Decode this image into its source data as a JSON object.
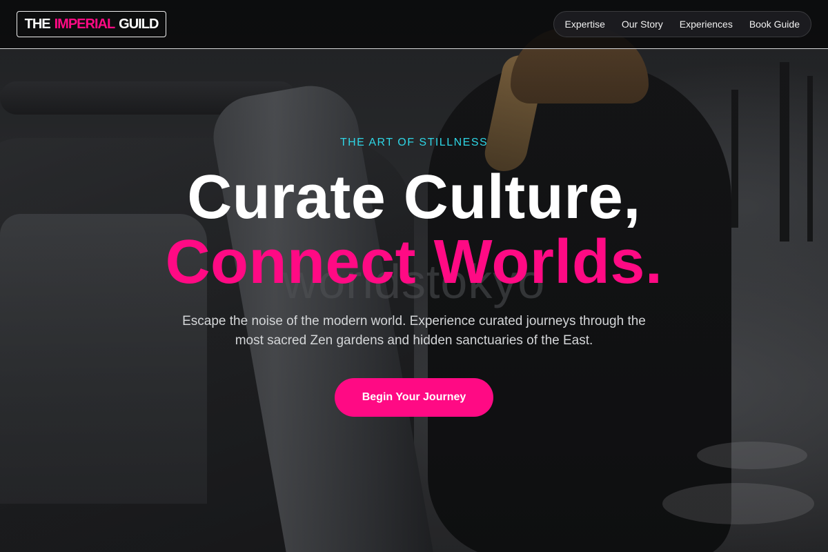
{
  "brand": {
    "logo_part1": "THE",
    "logo_part2": "IMPERIAL",
    "logo_part3": "GUILD"
  },
  "nav": {
    "items": [
      {
        "label": "Expertise"
      },
      {
        "label": "Our Story"
      },
      {
        "label": "Experiences"
      },
      {
        "label": "Book Guide"
      }
    ]
  },
  "hero": {
    "eyebrow": "THE ART OF STILLNESS",
    "headline_line1": "Curate Culture,",
    "headline_line2": "Connect Worlds.",
    "subtitle": "Escape the noise of the modern world. Experience curated journeys through the most sacred Zen gardens and hidden sanctuaries of the East.",
    "cta_label": "Begin Your Journey",
    "watermark": "worldstokyo"
  },
  "colors": {
    "accent": "#ff0a84",
    "eyebrow": "#2ed6e6",
    "text": "#ffffff"
  }
}
